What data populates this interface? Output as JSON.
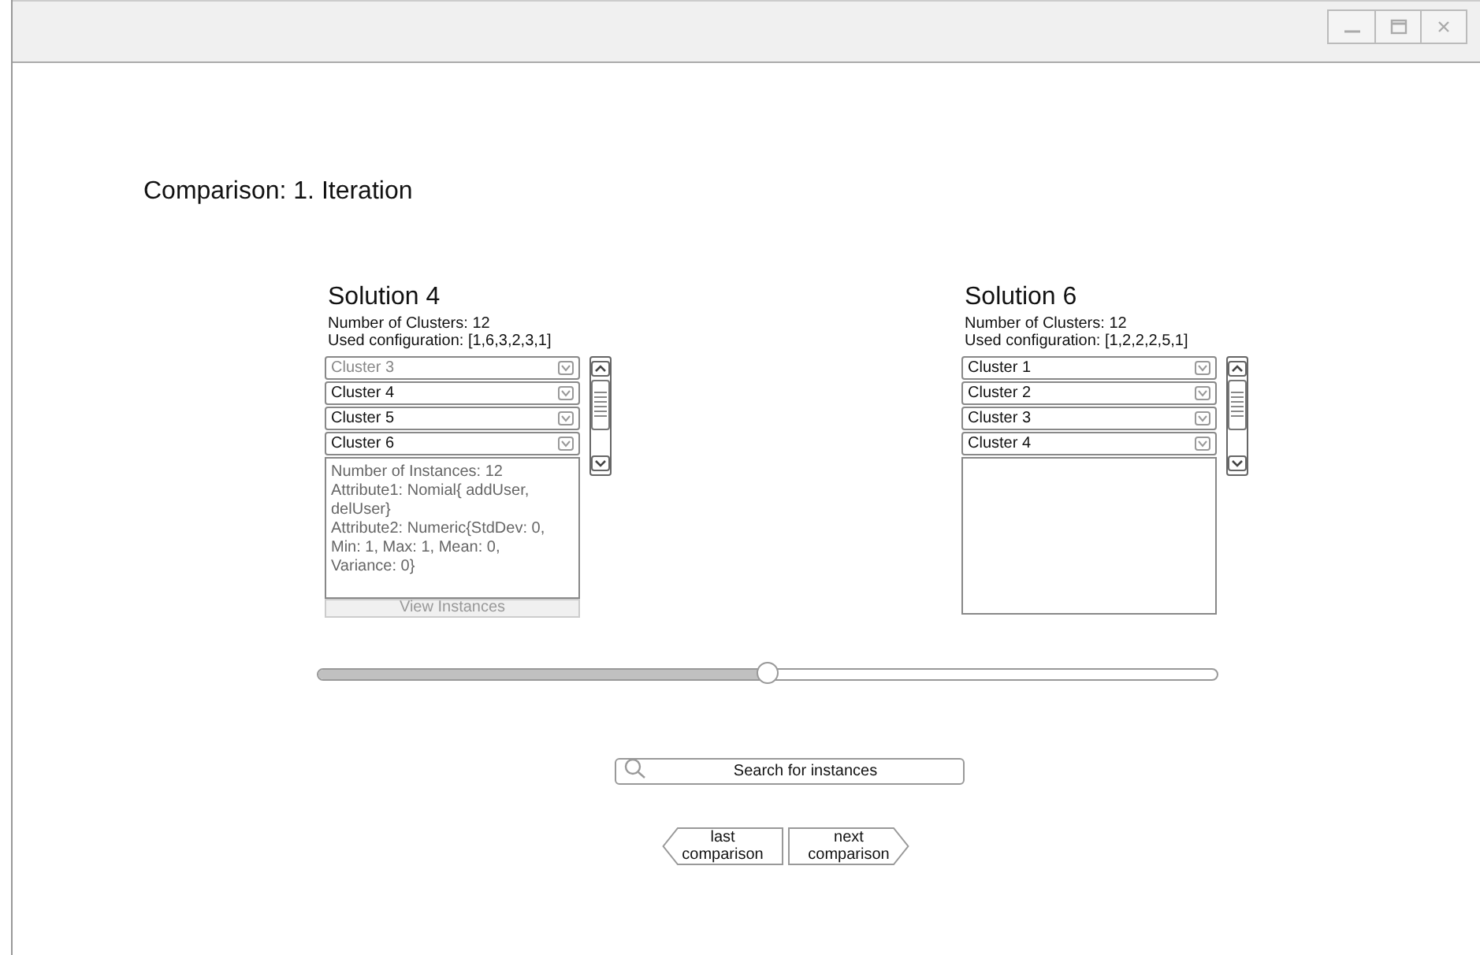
{
  "window": {
    "controls": [
      {
        "kind": "minimize"
      },
      {
        "kind": "maximize"
      },
      {
        "kind": "close"
      }
    ]
  },
  "heading": "Comparison: 1. Iteration",
  "solutions": [
    {
      "title": "Solution 4",
      "clusters_count": "Number of Clusters: 12",
      "configuration": "Used configuration: [1,6,3,2,3,1]",
      "clusters": [
        {
          "label": "Cluster 3",
          "disabled": true
        },
        {
          "label": "Cluster 4",
          "disabled": false
        },
        {
          "label": "Cluster 5",
          "disabled": false
        },
        {
          "label": "Cluster 6",
          "disabled": false
        }
      ],
      "details": [
        "Number of Instances: 12",
        "Attribute1: Nomial{ addUser, delUser}",
        "Attribute2: Numeric{StdDev: 0, Min: 1, Max: 1, Mean: 0, Variance: 0}"
      ],
      "button": {
        "label": "View Instances",
        "disabled": true
      }
    },
    {
      "title": "Solution 6",
      "clusters_count": "Number of Clusters: 12",
      "configuration": "Used configuration: [1,2,2,2,5,1]",
      "clusters": [
        {
          "label": "Cluster 1",
          "disabled": false
        },
        {
          "label": "Cluster 2",
          "disabled": false
        },
        {
          "label": "Cluster 3",
          "disabled": false
        },
        {
          "label": "Cluster 4",
          "disabled": false
        }
      ]
    }
  ],
  "slider": {
    "level": 0.5
  },
  "search": {
    "placeholder": "Search for instances"
  },
  "navigation": [
    {
      "kind": "back",
      "label": "last comparison"
    },
    {
      "kind": "forward",
      "label": "next comparison"
    }
  ]
}
